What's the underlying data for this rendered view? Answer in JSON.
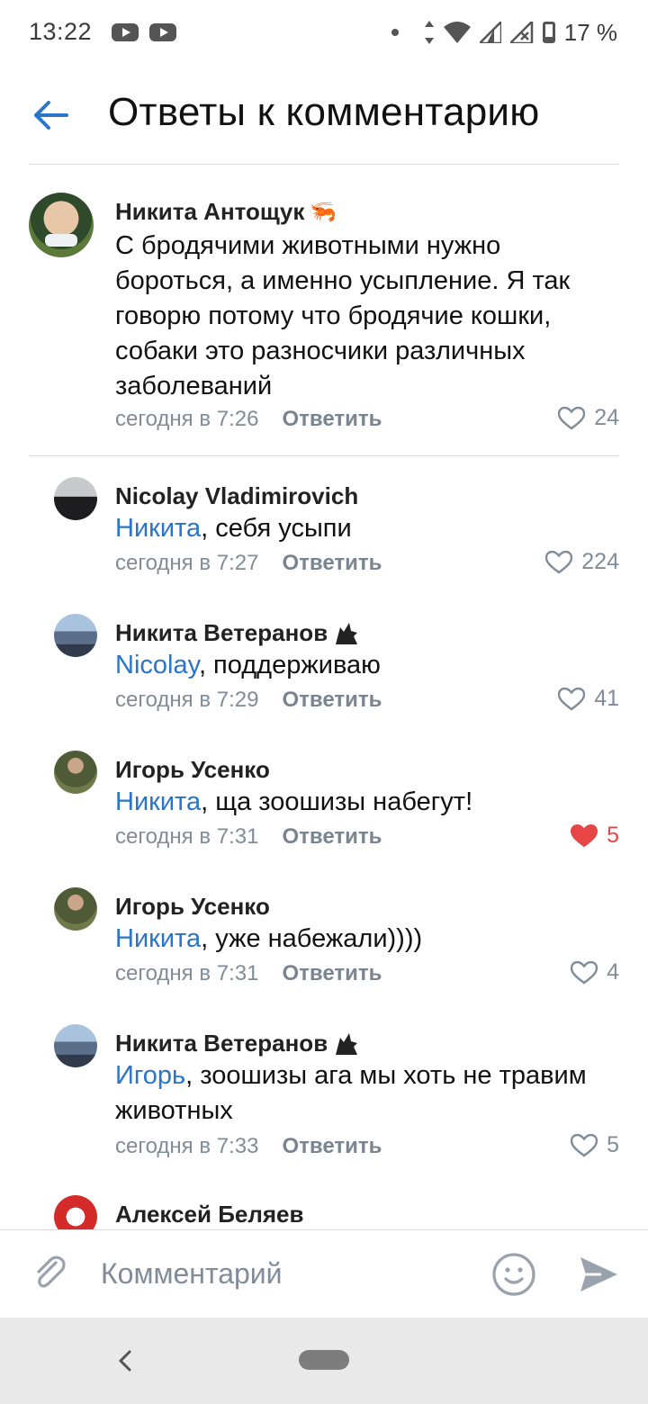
{
  "status_bar": {
    "time": "13:22",
    "battery": "17 %"
  },
  "header": {
    "title": "Ответы к комментарию"
  },
  "root_comment": {
    "author": "Никита Антощук",
    "emoji": "🦐",
    "lines": [
      "С бродячими животными нужно",
      "бороться, а именно усыпление. Я так",
      "говорю потому что бродячие кошки,",
      "собаки это разносчики различных",
      "заболеваний"
    ],
    "time": "сегодня в 7:26",
    "reply_label": "Ответить",
    "likes": "24"
  },
  "replies": [
    {
      "author": "Nicolay Vladimirovich",
      "mention": "Никита",
      "text": ", себя усыпи",
      "time": "сегодня в 7:27",
      "reply_label": "Ответить",
      "likes": "224"
    },
    {
      "author": "Никита Ветеранов",
      "mention": "Nicolay",
      "text": ", поддерживаю",
      "time": "сегодня в 7:29",
      "reply_label": "Ответить",
      "likes": "41"
    },
    {
      "author": "Игорь Усенко",
      "mention": "Никита",
      "text": ", ща зоошизы набегут!",
      "time": "сегодня в 7:31",
      "reply_label": "Ответить",
      "likes": "5"
    },
    {
      "author": "Игорь Усенко",
      "mention": "Никита",
      "text": ", уже набежали))))",
      "time": "сегодня в 7:31",
      "reply_label": "Ответить",
      "likes": "4"
    },
    {
      "author": "Никита Ветеранов",
      "mention": "Игорь",
      "text": ", зоошизы ага мы хоть не травим",
      "text2": "животных",
      "time": "сегодня в 7:33",
      "reply_label": "Ответить",
      "likes": "5"
    },
    {
      "author": "Алексей Беляев"
    }
  ],
  "composer": {
    "placeholder": "Комментарий"
  },
  "colors": {
    "accent": "#2a74c9",
    "liked": "#e64646",
    "muted": "#818c99"
  },
  "icons": [
    "back-arrow-icon",
    "heart-icon",
    "wolf-emoji-icon",
    "shrimp-emoji-icon",
    "paperclip-icon",
    "smile-icon",
    "send-icon"
  ]
}
